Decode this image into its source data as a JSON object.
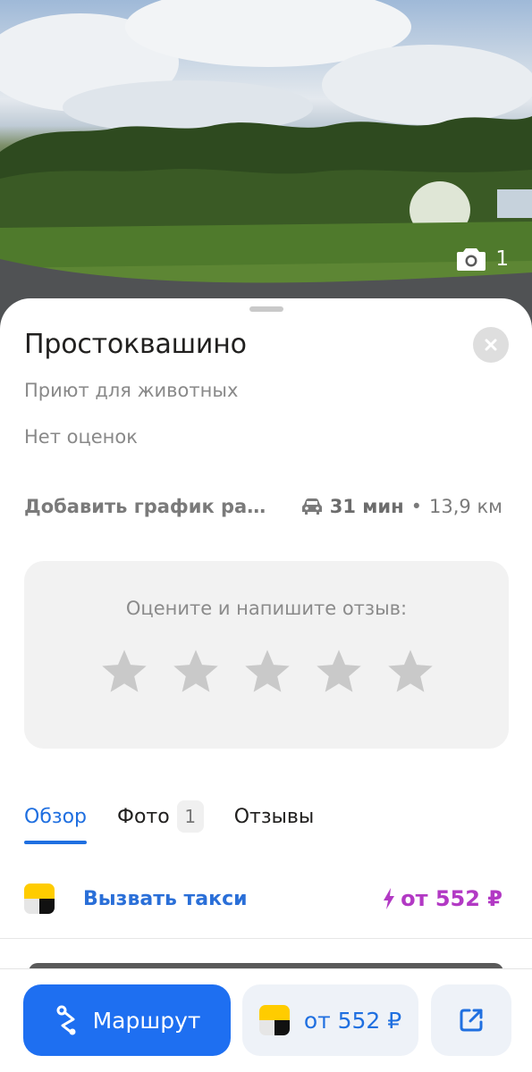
{
  "photo": {
    "count": "1",
    "icon": "camera-icon"
  },
  "place": {
    "name": "Простоквашино",
    "category": "Приют для животных",
    "rating_text": "Нет оценок",
    "schedule_link": "Добавить график работы",
    "drive_time": "31 мин",
    "separator": "•",
    "distance": "13,9 км"
  },
  "review": {
    "prompt": "Оцените и напишите отзыв:",
    "stars_total": 5,
    "stars_selected": 0
  },
  "tabs": [
    {
      "label": "Обзор",
      "active": true
    },
    {
      "label": "Фото",
      "badge": "1"
    },
    {
      "label": "Отзывы"
    }
  ],
  "taxi": {
    "label": "Вызвать такси",
    "price": "от 552 ₽"
  },
  "bottom": {
    "route_label": "Маршрут",
    "taxi_price": "от 552 ₽"
  },
  "colors": {
    "accent": "#1e6ff1",
    "taxi_price": "#b239c4",
    "taxi_yellow": "#ffcc00"
  }
}
